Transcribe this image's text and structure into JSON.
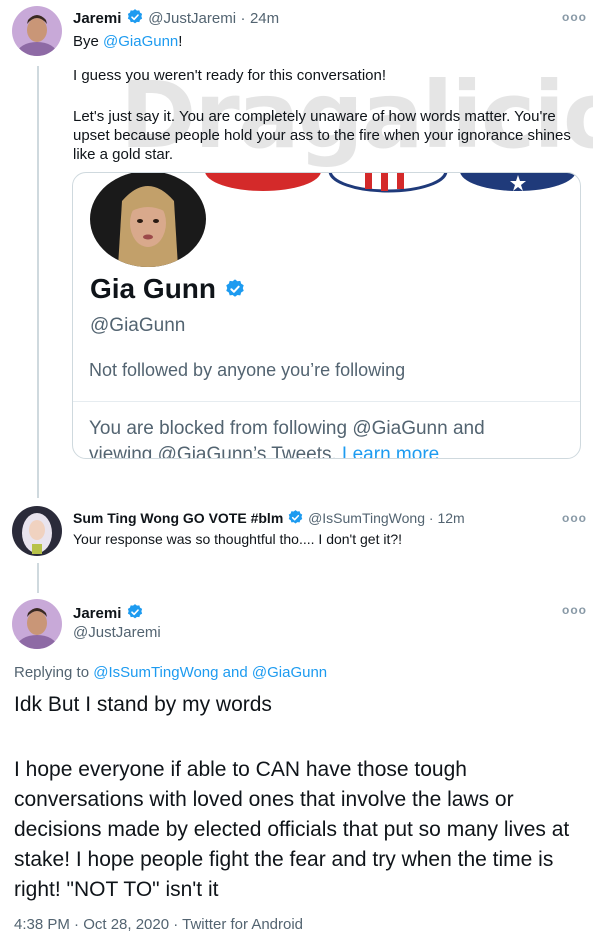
{
  "tweet1": {
    "author_name": "Jaremi",
    "author_handle": "@JustJaremi",
    "separator": "·",
    "time": "24m",
    "bye_prefix": "Bye ",
    "bye_mention": "@GiaGunn",
    "bye_suffix": "!",
    "paragraph1": "I guess you weren't ready for this conversation!",
    "paragraph2": "Let's just say it. You are completely unaware of how words matter. You're upset because people hold your ass to the fire when your ignorance shines like a gold star.",
    "watermark": "Dragalicious",
    "more_icon": "more-horizontal-icon"
  },
  "embedded_card": {
    "profile_name": "Gia Gunn",
    "profile_handle": "@GiaGunn",
    "follow_status": "Not followed by anyone you’re following",
    "blocked_text": "You are blocked from following @GiaGunn and viewing @GiaGunn’s Tweets.",
    "learn_more": "Learn more"
  },
  "tweet2": {
    "author_name": "Sum Ting Wong GO VOTE #blm",
    "author_handle": "@IsSumTingWong",
    "separator": "·",
    "time": "12m",
    "text": "Your response was so thoughtful tho.... I don't get it?!"
  },
  "tweet3": {
    "author_name": "Jaremi",
    "author_handle": "@JustJaremi",
    "replying_prefix": "Replying to ",
    "reply_mention1": "@IsSumTingWong",
    "reply_and": " and ",
    "reply_mention2": "@GiaGunn",
    "paragraph1": "Idk But I stand by my words",
    "paragraph2": "I hope everyone if able to CAN have those tough conversations with loved ones that involve the laws or decisions made by elected officials that put so many lives at stake! I hope people fight the fear and try when the time is right!  \"NOT TO\" isn't it",
    "timestamp": "4:38 PM · Oct 28, 2020 · Twitter for Android"
  },
  "colors": {
    "link": "#1d9bf0",
    "verified": "#1d9bf0",
    "secondary_text": "#536471",
    "thread_line": "#cfd9de"
  }
}
